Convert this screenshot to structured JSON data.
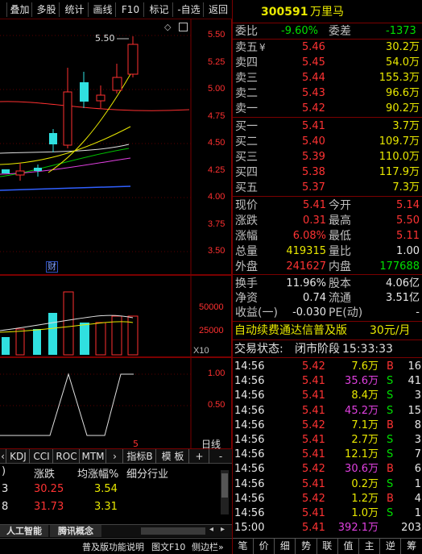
{
  "toolbar": {
    "buttons": [
      "叠加",
      "多股",
      "统计",
      "画线",
      "F10",
      "标记",
      "-自选",
      "返回"
    ]
  },
  "kline": {
    "price_labels": [
      "5.50",
      "5.25",
      "5.00",
      "4.75",
      "4.50",
      "4.25",
      "4.00",
      "3.75",
      "3.50"
    ],
    "high_annotation": "5.50",
    "badge": "财",
    "icons": [
      "diamond-icon",
      "checkbox-icon"
    ]
  },
  "volume": {
    "labels": [
      "50000",
      "25000"
    ],
    "multiplier": "X10"
  },
  "indicator": {
    "labels": [
      "1.00",
      "0.50"
    ],
    "marker": "5",
    "period": "日线"
  },
  "indicator_tabs": [
    "KDJ",
    "CCI",
    "ROC",
    "MTM",
    "指标B",
    "模 板",
    "+",
    "-"
  ],
  "sector_table": {
    "headers": [
      "涨跌",
      "均涨幅%",
      "细分行业"
    ],
    "rows": [
      {
        "idx": "3",
        "change": "30.25",
        "avg": "3.54",
        "industry": ""
      },
      {
        "idx": "8",
        "change": "31.73",
        "avg": "3.31",
        "industry": ""
      }
    ]
  },
  "sector_tabs": [
    "人工智能",
    "腾讯概念"
  ],
  "status_bar": [
    "普及版功能说明",
    "图文F10",
    "侧边栏»"
  ],
  "quote": {
    "code": "300591",
    "name": "万里马",
    "weibi_label": "委比",
    "weibi_value": "-9.60%",
    "weicha_label": "委差",
    "weicha_value": "-1373",
    "asks": [
      {
        "label": "卖五",
        "mark": "¥",
        "price": "5.46",
        "vol": "30.2万"
      },
      {
        "label": "卖四",
        "mark": "",
        "price": "5.45",
        "vol": "54.0万"
      },
      {
        "label": "卖三",
        "mark": "",
        "price": "5.44",
        "vol": "155.3万"
      },
      {
        "label": "卖二",
        "mark": "",
        "price": "5.43",
        "vol": "96.6万"
      },
      {
        "label": "卖一",
        "mark": "",
        "price": "5.42",
        "vol": "90.2万"
      }
    ],
    "bids": [
      {
        "label": "买一",
        "price": "5.41",
        "vol": "3.7万"
      },
      {
        "label": "买二",
        "price": "5.40",
        "vol": "109.7万"
      },
      {
        "label": "买三",
        "price": "5.39",
        "vol": "110.0万"
      },
      {
        "label": "买四",
        "price": "5.38",
        "vol": "117.9万"
      },
      {
        "label": "买五",
        "price": "5.37",
        "vol": "7.3万"
      }
    ],
    "stats": [
      {
        "l1": "现价",
        "v1": "5.41",
        "c1": "red",
        "l2": "今开",
        "v2": "5.14",
        "c2": "red"
      },
      {
        "l1": "涨跌",
        "v1": "0.31",
        "c1": "red",
        "l2": "最高",
        "v2": "5.50",
        "c2": "red"
      },
      {
        "l1": "涨幅",
        "v1": "6.08%",
        "c1": "red",
        "l2": "最低",
        "v2": "5.11",
        "c2": "red"
      },
      {
        "l1": "总量",
        "v1": "419315",
        "c1": "yellow",
        "l2": "量比",
        "v2": "1.00",
        "c2": "white"
      },
      {
        "l1": "外盘",
        "v1": "241627",
        "c1": "red",
        "l2": "内盘",
        "v2": "177688",
        "c2": "green"
      }
    ],
    "fin": [
      {
        "l1": "换手",
        "v1": "11.96%",
        "l2": "股本",
        "v2": "4.06亿"
      },
      {
        "l1": "净资",
        "v1": "0.74",
        "l2": "流通",
        "v2": "3.51亿"
      },
      {
        "l1": "收益(一)",
        "v1": "-0.030",
        "l2": "PE(动)",
        "v2": "-"
      }
    ],
    "ad_text": "自动续费通达信普及版",
    "ad_price": "30元/月",
    "trade_status_label": "交易状态:",
    "trade_status": "闭市阶段",
    "trade_time": "15:33:33",
    "ticks": [
      {
        "time": "14:56",
        "price": "5.42",
        "pc": "red",
        "vol": "7.6万",
        "vc": "yellow",
        "side": "B",
        "sc": "red",
        "num": "16"
      },
      {
        "time": "14:56",
        "price": "5.41",
        "pc": "red",
        "vol": "35.6万",
        "vc": "magenta",
        "side": "S",
        "sc": "green",
        "num": "41"
      },
      {
        "time": "14:56",
        "price": "5.41",
        "pc": "red",
        "vol": "8.4万",
        "vc": "yellow",
        "side": "S",
        "sc": "green",
        "num": "3"
      },
      {
        "time": "14:56",
        "price": "5.41",
        "pc": "red",
        "vol": "45.2万",
        "vc": "magenta",
        "side": "S",
        "sc": "green",
        "num": "15"
      },
      {
        "time": "14:56",
        "price": "5.42",
        "pc": "red",
        "vol": "7.1万",
        "vc": "yellow",
        "side": "B",
        "sc": "red",
        "num": "8"
      },
      {
        "time": "14:56",
        "price": "5.41",
        "pc": "red",
        "vol": "2.7万",
        "vc": "yellow",
        "side": "S",
        "sc": "green",
        "num": "3"
      },
      {
        "time": "14:56",
        "price": "5.41",
        "pc": "red",
        "vol": "12.1万",
        "vc": "yellow",
        "side": "S",
        "sc": "green",
        "num": "7"
      },
      {
        "time": "14:56",
        "price": "5.42",
        "pc": "red",
        "vol": "30.6万",
        "vc": "magenta",
        "side": "B",
        "sc": "red",
        "num": "6"
      },
      {
        "time": "14:56",
        "price": "5.41",
        "pc": "red",
        "vol": "0.2万",
        "vc": "yellow",
        "side": "S",
        "sc": "green",
        "num": "1"
      },
      {
        "time": "14:56",
        "price": "5.42",
        "pc": "red",
        "vol": "1.2万",
        "vc": "yellow",
        "side": "B",
        "sc": "red",
        "num": "4"
      },
      {
        "time": "14:56",
        "price": "5.41",
        "pc": "red",
        "vol": "1.0万",
        "vc": "yellow",
        "side": "S",
        "sc": "green",
        "num": "1"
      },
      {
        "time": "15:00",
        "price": "5.41",
        "pc": "red",
        "vol": "392.1万",
        "vc": "magenta",
        "side": "",
        "sc": "white",
        "num": "203"
      }
    ],
    "bottom_tabs": [
      "笔",
      "价",
      "细",
      "势",
      "联",
      "值",
      "主",
      "逆",
      "筹"
    ]
  },
  "colors": {
    "up": "#ff3333",
    "down": "#00e000",
    "frame": "#7a0000",
    "volume_bar": "#30e0e0"
  }
}
